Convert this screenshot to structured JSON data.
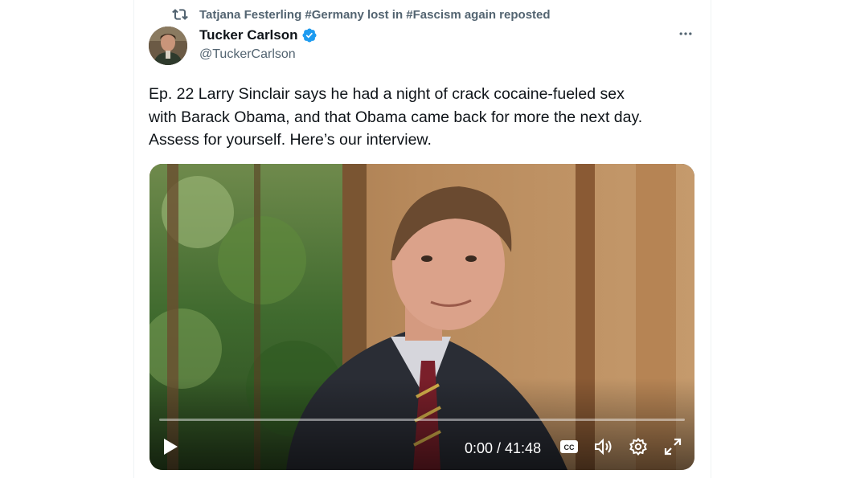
{
  "repost": {
    "text": "Tatjana Festerling #Germany lost in #Fascism again reposted",
    "icon": "repost-icon"
  },
  "author": {
    "name": "Tucker Carlson",
    "handle": "@TuckerCarlson",
    "verified_icon": "verified-badge-icon",
    "verified_color": "#1d9bf0"
  },
  "more_icon": "more-horizontal-icon",
  "tweet": {
    "text": "Ep. 22  Larry Sinclair says he had a night of crack cocaine-fueled sex\nwith Barack Obama, and that Obama came back for more the next day.\nAssess for yourself. Here’s our interview."
  },
  "video": {
    "time_display": "0:00 / 41:48",
    "progress": 0,
    "controls": [
      "play-icon",
      "cc-icon",
      "volume-icon",
      "settings-icon",
      "fullscreen-icon"
    ]
  },
  "colors": {
    "text_primary": "#0f1419",
    "text_secondary": "#536471",
    "accent": "#1d9bf0"
  }
}
